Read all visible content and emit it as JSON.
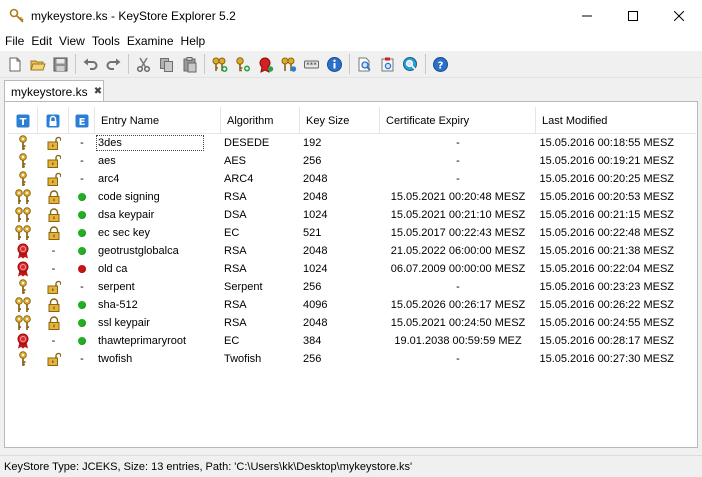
{
  "window": {
    "title": "mykeystore.ks - KeyStore Explorer 5.2"
  },
  "menu": [
    "File",
    "Edit",
    "View",
    "Tools",
    "Examine",
    "Help"
  ],
  "toolbar": {
    "buttons": [
      {
        "name": "new-icon"
      },
      {
        "name": "open-icon"
      },
      {
        "name": "save-icon"
      },
      {
        "sep": true
      },
      {
        "name": "undo-icon"
      },
      {
        "name": "redo-icon"
      },
      {
        "sep": true
      },
      {
        "name": "cut-icon"
      },
      {
        "name": "copy-icon"
      },
      {
        "name": "paste-icon"
      },
      {
        "sep": true
      },
      {
        "name": "generate-keypair-icon"
      },
      {
        "name": "generate-secret-key-icon"
      },
      {
        "name": "import-trusted-cert-icon"
      },
      {
        "name": "import-keypair-icon"
      },
      {
        "name": "set-password-icon"
      },
      {
        "name": "properties-icon"
      },
      {
        "sep": true
      },
      {
        "name": "examine-file-icon"
      },
      {
        "name": "examine-clipboard-icon"
      },
      {
        "name": "examine-ssl-icon"
      },
      {
        "sep": true
      },
      {
        "name": "help-icon"
      }
    ]
  },
  "tab": {
    "label": "mykeystore.ks",
    "close": "✖"
  },
  "table": {
    "headers": {
      "type": "T",
      "lock": "lock",
      "expiry": "E",
      "name": "Entry Name",
      "algorithm": "Algorithm",
      "key_size": "Key Size",
      "cert_expiry": "Certificate Expiry",
      "last_modified": "Last Modified"
    },
    "rows": [
      {
        "type": "key",
        "lock": "open",
        "status": "none",
        "name": "3des",
        "algorithm": "DESEDE",
        "key_size": "192",
        "cert_expiry": "-",
        "last_modified": "15.05.2016 00:18:55 MESZ"
      },
      {
        "type": "key",
        "lock": "open",
        "status": "none",
        "name": "aes",
        "algorithm": "AES",
        "key_size": "256",
        "cert_expiry": "-",
        "last_modified": "15.05.2016 00:19:21 MESZ"
      },
      {
        "type": "key",
        "lock": "open",
        "status": "none",
        "name": "arc4",
        "algorithm": "ARC4",
        "key_size": "2048",
        "cert_expiry": "-",
        "last_modified": "15.05.2016 00:20:25 MESZ"
      },
      {
        "type": "keypair",
        "lock": "closed",
        "status": "green",
        "name": "code signing",
        "algorithm": "RSA",
        "key_size": "2048",
        "cert_expiry": "15.05.2021 00:20:48 MESZ",
        "last_modified": "15.05.2016 00:20:53 MESZ"
      },
      {
        "type": "keypair",
        "lock": "closed",
        "status": "green",
        "name": "dsa keypair",
        "algorithm": "DSA",
        "key_size": "1024",
        "cert_expiry": "15.05.2021 00:21:10 MESZ",
        "last_modified": "15.05.2016 00:21:15 MESZ"
      },
      {
        "type": "keypair",
        "lock": "closed",
        "status": "green",
        "name": "ec sec key",
        "algorithm": "EC",
        "key_size": "521",
        "cert_expiry": "15.05.2017 00:22:43 MESZ",
        "last_modified": "15.05.2016 00:22:48 MESZ"
      },
      {
        "type": "cert",
        "lock": "none",
        "status": "green",
        "name": "geotrustglobalca",
        "algorithm": "RSA",
        "key_size": "2048",
        "cert_expiry": "21.05.2022 06:00:00 MESZ",
        "last_modified": "15.05.2016 00:21:38 MESZ"
      },
      {
        "type": "cert",
        "lock": "none",
        "status": "red",
        "name": "old ca",
        "algorithm": "RSA",
        "key_size": "1024",
        "cert_expiry": "06.07.2009 00:00:00 MESZ",
        "last_modified": "15.05.2016 00:22:04 MESZ"
      },
      {
        "type": "key",
        "lock": "open",
        "status": "none",
        "name": "serpent",
        "algorithm": "Serpent",
        "key_size": "256",
        "cert_expiry": "-",
        "last_modified": "15.05.2016 00:23:23 MESZ"
      },
      {
        "type": "keypair",
        "lock": "closed",
        "status": "green",
        "name": "sha-512",
        "algorithm": "RSA",
        "key_size": "4096",
        "cert_expiry": "15.05.2026 00:26:17 MESZ",
        "last_modified": "15.05.2016 00:26:22 MESZ"
      },
      {
        "type": "keypair",
        "lock": "closed",
        "status": "green",
        "name": "ssl keypair",
        "algorithm": "RSA",
        "key_size": "2048",
        "cert_expiry": "15.05.2021 00:24:50 MESZ",
        "last_modified": "15.05.2016 00:24:55 MESZ"
      },
      {
        "type": "cert",
        "lock": "none",
        "status": "green",
        "name": "thawteprimaryroot",
        "algorithm": "EC",
        "key_size": "384",
        "cert_expiry": "19.01.2038 00:59:59 MEZ",
        "last_modified": "15.05.2016 00:28:17 MESZ"
      },
      {
        "type": "key",
        "lock": "open",
        "status": "none",
        "name": "twofish",
        "algorithm": "Twofish",
        "key_size": "256",
        "cert_expiry": "-",
        "last_modified": "15.05.2016 00:27:30 MESZ"
      }
    ]
  },
  "statusbar": {
    "text": "KeyStore Type: JCEKS, Size: 13 entries, Path: 'C:\\Users\\kk\\Desktop\\mykeystore.ks'"
  },
  "colors": {
    "green": "#22b022",
    "red": "#c81414",
    "gold": "#d9a21b",
    "blue_header": "#2a7fd4"
  }
}
